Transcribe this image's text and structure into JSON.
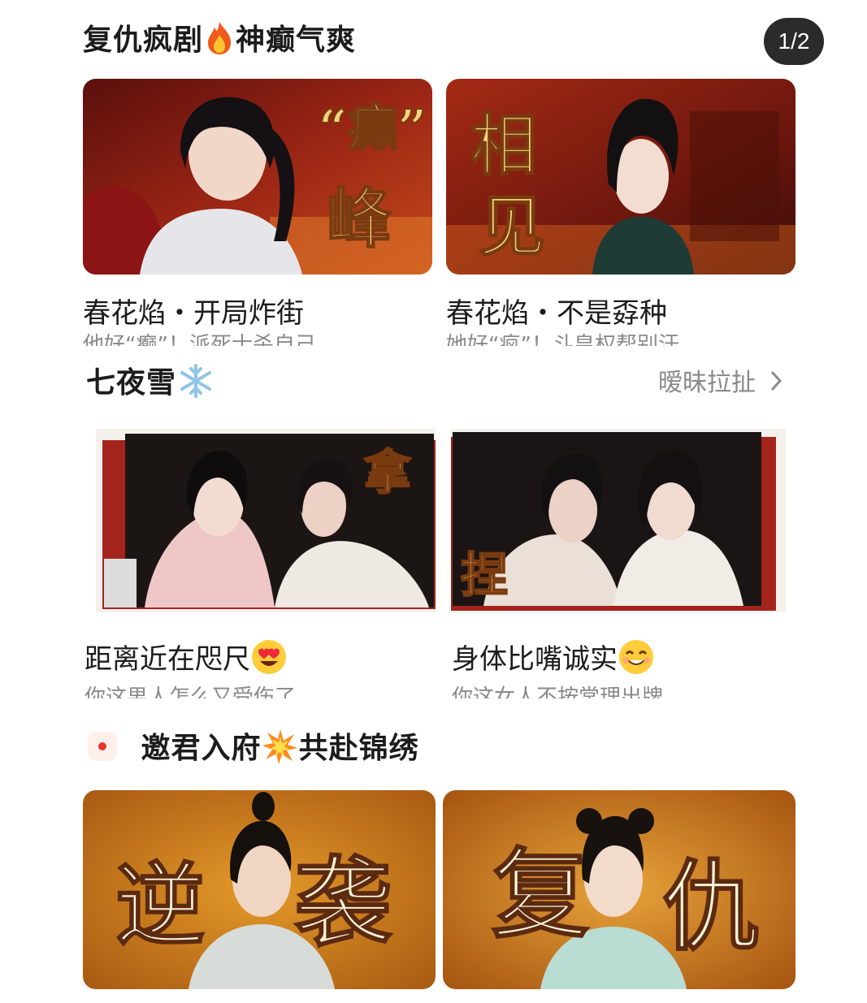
{
  "section1": {
    "title": "复仇疯剧",
    "title_emoji": "fire-icon",
    "title_tail": "神癫气爽",
    "pager": "1/2",
    "cards": [
      {
        "overlay_text": "“癫”峰",
        "caption": "春花焰・开局炸街",
        "subcaption": "他好“癫”！派死士杀自己"
      },
      {
        "overlay_text": "相见",
        "caption": "春花焰・不是孬种",
        "subcaption": "她好“疯”！斗皇权帮别汗"
      }
    ]
  },
  "section2": {
    "title": "七夜雪",
    "title_emoji": "snowflake-icon",
    "more_label": "暧昧拉扯",
    "cards": [
      {
        "overlay_text": "拿",
        "caption": "距离近在咫尺",
        "caption_emoji": "heart-eyes-emoji",
        "subcaption": "你这男人怎么又受伤了"
      },
      {
        "overlay_text": "捏",
        "caption": "身体比嘴诚实",
        "caption_emoji": "blush-smile-emoji",
        "subcaption": "你这女人不按常理出牌"
      }
    ]
  },
  "section3": {
    "title_prefix_icon": "play-icon",
    "title": "邀君入府",
    "title_emoji": "collision-icon",
    "title_tail": "共赴锦绣",
    "cards": [
      {
        "overlay_text": "逆袭"
      },
      {
        "overlay_text": "复仇"
      }
    ]
  },
  "colors": {
    "background": "#ffffff",
    "red_card_bg": "#9e1f12",
    "gold_card_bg": "#c9831a",
    "title_text": "#1c1c1c",
    "muted_text": "#8a8a8a"
  }
}
